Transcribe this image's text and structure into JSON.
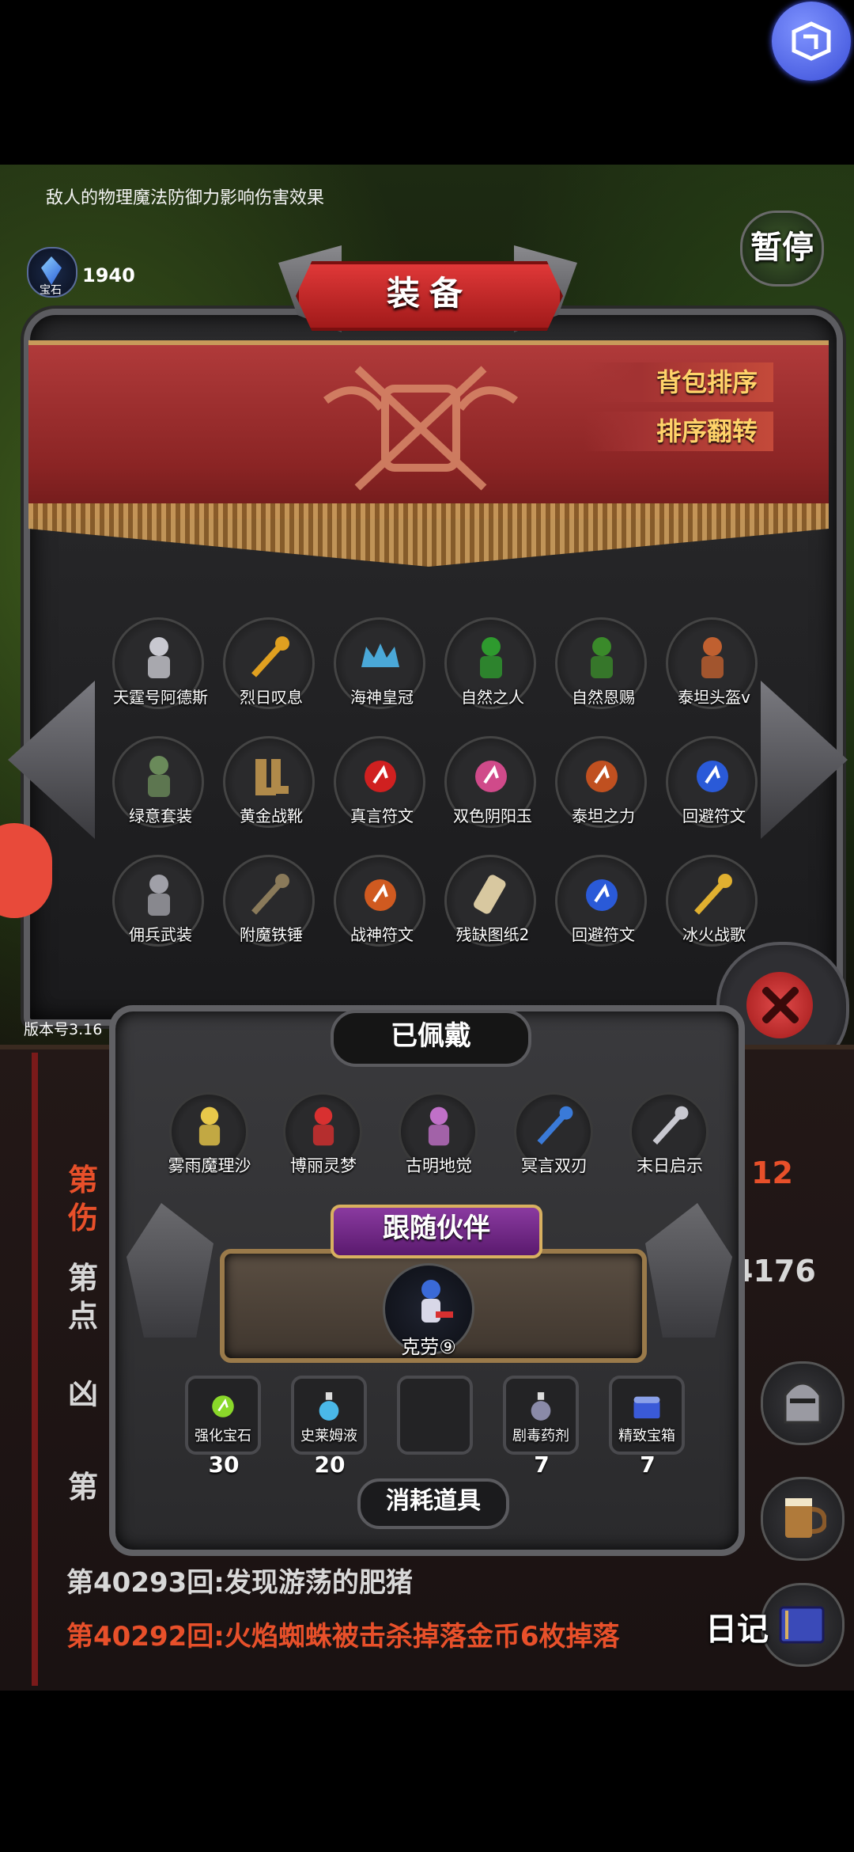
{
  "tip_text": "敌人的物理魔法防御力影响伤害效果",
  "gem": {
    "count": "1940",
    "label": "宝石"
  },
  "pause_label": "暂停",
  "equipment": {
    "title": "装备",
    "sort_button": "背包排序",
    "reverse_button": "排序翻转",
    "items": [
      {
        "name": "天霆号阿德斯",
        "icon": "mech-armor-icon",
        "color": "#c8c8d0"
      },
      {
        "name": "烈日叹息",
        "icon": "golden-staff-icon",
        "color": "#e0a020"
      },
      {
        "name": "海神皇冠",
        "icon": "crown-icon",
        "color": "#4aa8d8"
      },
      {
        "name": "自然之人",
        "icon": "green-figure-icon",
        "color": "#2e9a2e"
      },
      {
        "name": "自然恩赐",
        "icon": "green-gift-icon",
        "color": "#3a8a2a"
      },
      {
        "name": "泰坦头盔v",
        "icon": "spartan-helmet-icon",
        "color": "#c06030"
      },
      {
        "name": "绿意套装",
        "icon": "green-armor-icon",
        "color": "#6a8a5a"
      },
      {
        "name": "黄金战靴",
        "icon": "boots-icon",
        "color": "#b08a4a"
      },
      {
        "name": "真言符文",
        "icon": "red-rune-icon",
        "color": "#d02020"
      },
      {
        "name": "双色阴阳玉",
        "icon": "yin-yang-orb-icon",
        "color": "#d04a8a"
      },
      {
        "name": "泰坦之力",
        "icon": "titan-rune-icon",
        "color": "#c05020"
      },
      {
        "name": "回避符文",
        "icon": "blue-rune-icon",
        "color": "#2a5ad8"
      },
      {
        "name": "佣兵武装",
        "icon": "knight-armor-icon",
        "color": "#a0a0a8"
      },
      {
        "name": "附魔铁锤",
        "icon": "hammer-icon",
        "color": "#8a7a5a"
      },
      {
        "name": "战神符文",
        "icon": "fire-rune-icon",
        "color": "#d05a20"
      },
      {
        "name": "残缺图纸2",
        "icon": "scroll-icon",
        "color": "#d8c8a0"
      },
      {
        "name": "回避符文",
        "icon": "blue-rune-icon",
        "color": "#2a5ad8"
      },
      {
        "name": "冰火战歌",
        "icon": "crossed-swords-icon",
        "color": "#e0b030"
      }
    ]
  },
  "version": "版本号3.16",
  "worn": {
    "title": "已佩戴",
    "items": [
      {
        "name": "雾雨魔理沙",
        "icon": "witch-icon",
        "color": "#e8c84a"
      },
      {
        "name": "博丽灵梦",
        "icon": "shrine-maiden-icon",
        "color": "#d83030"
      },
      {
        "name": "古明地觉",
        "icon": "pink-hair-girl-icon",
        "color": "#c070c8"
      },
      {
        "name": "冥言双刃",
        "icon": "twin-blades-icon",
        "color": "#3a7ad8"
      },
      {
        "name": "末日启示",
        "icon": "axe-icon",
        "color": "#c8c8d0"
      }
    ]
  },
  "companion": {
    "title": "跟随伙伴",
    "name": "克劳⑨",
    "icon": "companion-icon",
    "color": "#3a6ad8"
  },
  "consumables": {
    "title": "消耗道具",
    "items": [
      {
        "name": "强化宝石",
        "qty": "30",
        "icon": "green-gem-icon",
        "color": "#8ad82a"
      },
      {
        "name": "史莱姆液",
        "qty": "20",
        "icon": "potion-icon",
        "color": "#4ab8e8"
      },
      {
        "name": "",
        "qty": "",
        "icon": "",
        "color": "#2a2a2c"
      },
      {
        "name": "剧毒药剂",
        "qty": "7",
        "icon": "poison-icon",
        "color": "#8a8aa8"
      },
      {
        "name": "精致宝箱",
        "qty": "7",
        "icon": "chest-icon",
        "color": "#3a5ad8"
      }
    ]
  },
  "log": {
    "lines": [
      {
        "text": "第40293回:发现游荡的肥猪",
        "color": "#d8d8d8"
      },
      {
        "text": "第40292回:火焰蜘蛛被击杀掉落金币6枚掉落",
        "color": "#e8502a"
      }
    ],
    "partial": {
      "left_top": "第",
      "left_top2": "伤",
      "left_mid": "第",
      "left_mid2": "点",
      "left_mid3": "凶",
      "left_low": "第",
      "right_top": "12",
      "right_mid": "4176"
    }
  },
  "side_icons": {
    "diary_label": "日记"
  }
}
